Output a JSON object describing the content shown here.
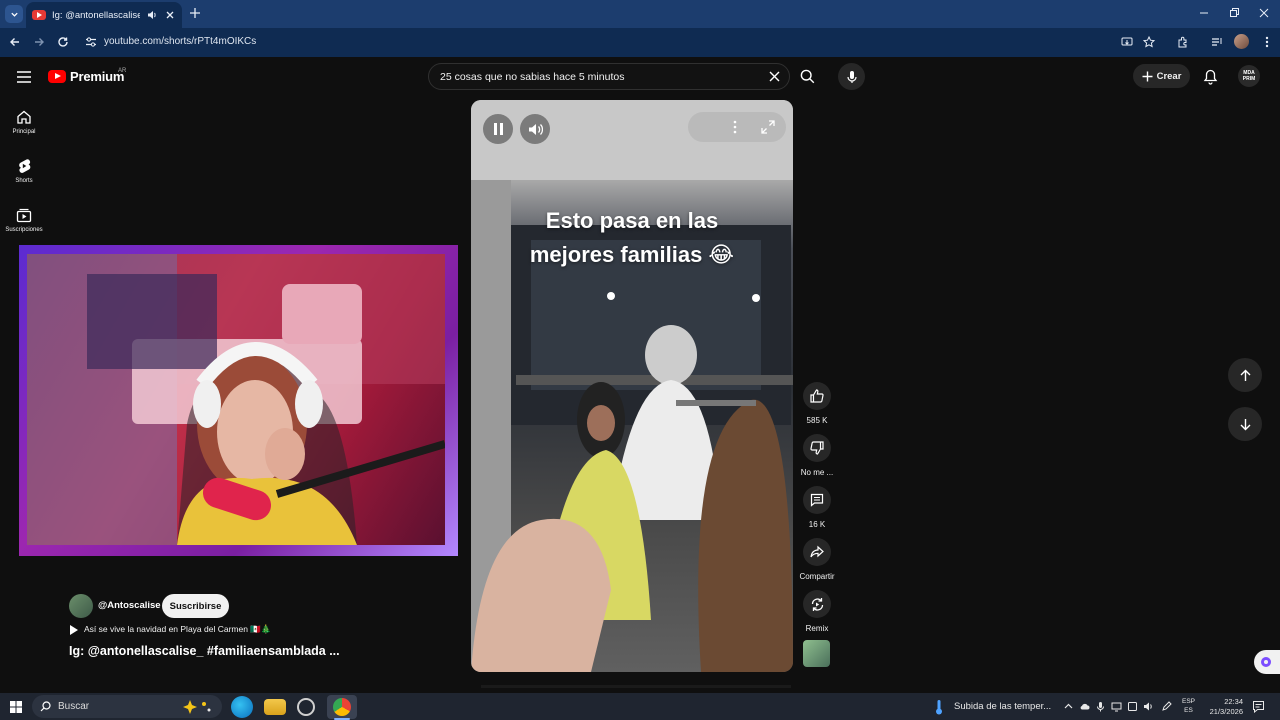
{
  "browser": {
    "tab_title": "Ig: @antonellascalise_ #fam",
    "url": "youtube.com/shorts/rPTt4mOIKCs"
  },
  "youtube": {
    "logo_text": "Premium",
    "country": "AR",
    "search_query": "25 cosas que no sabias hace 5 minutos",
    "create_label": "Crear",
    "avatar_text": "MDA PRIM"
  },
  "nav": {
    "items": [
      {
        "label": "Principal",
        "icon": "home-icon"
      },
      {
        "label": "Shorts",
        "icon": "shorts-icon"
      },
      {
        "label": "Suscripciones",
        "icon": "subscriptions-icon"
      }
    ]
  },
  "short": {
    "overlay_line1": "Esto pasa en las",
    "overlay_line2": "mejores familias 😂",
    "channel": "@Antoscalise",
    "subscribe_label": "Suscribirse",
    "music": "Así se vive la navidad en Playa del Carmen 🇲🇽🎄",
    "title": "Ig: @antonellascalise_ #familiaensamblada ...",
    "actions": {
      "like_count": "585 K",
      "dislike_label": "No me ...",
      "comments_count": "16 K",
      "share_label": "Compartir",
      "remix_label": "Remix"
    }
  },
  "taskbar": {
    "search_placeholder": "Buscar",
    "weather": "Subida de las temper...",
    "lang_top": "ESP",
    "lang_bottom": "ES",
    "time": "22:34",
    "date": "21/3/2026"
  },
  "colors": {
    "tab_bar": "#1c3d6e",
    "toolbar": "#0f2b52",
    "yt_background": "#0f0f0f",
    "yt_red": "#ff0000",
    "webcam_border": "#9c27b0"
  }
}
